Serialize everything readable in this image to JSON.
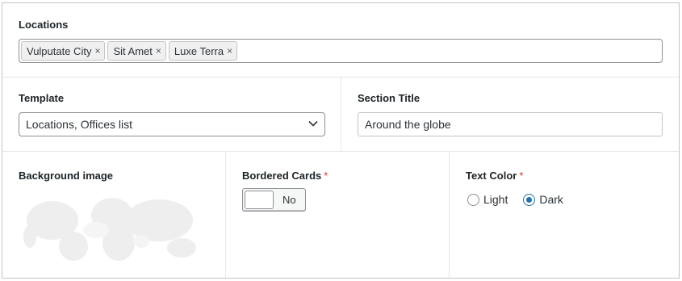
{
  "locations": {
    "label": "Locations",
    "tags": [
      {
        "label": "Vulputate City",
        "remove": "×"
      },
      {
        "label": "Sit Amet",
        "remove": "×"
      },
      {
        "label": "Luxe Terra",
        "remove": "×"
      }
    ]
  },
  "template": {
    "label": "Template",
    "selected": "Locations, Offices list"
  },
  "section_title": {
    "label": "Section Title",
    "value": "Around the globe"
  },
  "background_image": {
    "label": "Background image"
  },
  "bordered_cards": {
    "label": "Bordered Cards",
    "required_mark": "*",
    "toggle_text": "No"
  },
  "text_color": {
    "label": "Text Color",
    "required_mark": "*",
    "options": [
      {
        "label": "Light",
        "checked": false
      },
      {
        "label": "Dark",
        "checked": true
      }
    ]
  },
  "colors": {
    "accent": "#2271b1",
    "required": "#d63638"
  }
}
